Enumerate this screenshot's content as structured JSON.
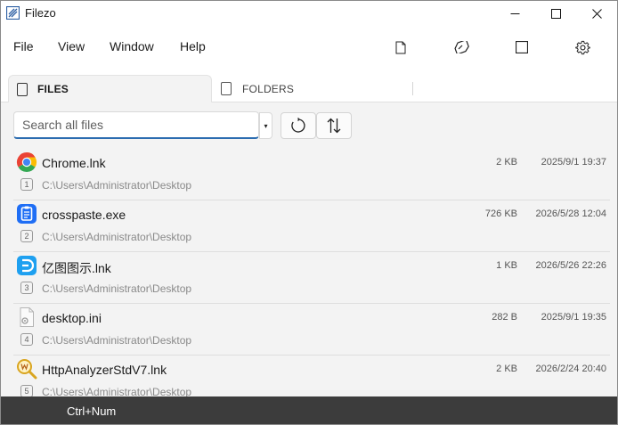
{
  "window": {
    "title": "Filezo",
    "controls": [
      "minimize-icon",
      "maximize-icon",
      "close-icon"
    ]
  },
  "menu": {
    "items": [
      "File",
      "View",
      "Window",
      "Help"
    ],
    "tools": [
      "new-file-icon",
      "eraser-icon",
      "square-icon",
      "gear-icon"
    ]
  },
  "tabs": {
    "files": "FILES",
    "folders": "FOLDERS",
    "active": "FILES"
  },
  "search": {
    "placeholder": "Search all files",
    "value": "",
    "dropdown_glyph": "▾"
  },
  "toolbar": {
    "refresh_icon": "refresh-icon",
    "sort_icon": "sort-icon"
  },
  "files": [
    {
      "name": "Chrome.lnk",
      "size": "2 KB",
      "date": "2025/9/1 19:37",
      "num": "1",
      "path": "C:\\Users\\Administrator\\Desktop",
      "icon": "chrome-icon"
    },
    {
      "name": "crosspaste.exe",
      "size": "726 KB",
      "date": "2026/5/28 12:04",
      "num": "2",
      "path": "C:\\Users\\Administrator\\Desktop",
      "icon": "crosspaste-icon"
    },
    {
      "name": "亿图图示.lnk",
      "size": "1 KB",
      "date": "2026/5/26 22:26",
      "num": "3",
      "path": "C:\\Users\\Administrator\\Desktop",
      "icon": "edraw-icon"
    },
    {
      "name": "desktop.ini",
      "size": "282 B",
      "date": "2025/9/1 19:35",
      "num": "4",
      "path": "C:\\Users\\Administrator\\Desktop",
      "icon": "settings-file-icon"
    },
    {
      "name": "HttpAnalyzerStdV7.lnk",
      "size": "2 KB",
      "date": "2026/2/24 20:40",
      "num": "5",
      "path": "C:\\Users\\Administrator\\Desktop",
      "icon": "magnifier-icon"
    }
  ],
  "status": {
    "text": "Ctrl+Num"
  },
  "colors": {
    "accent": "#2b6cb0",
    "statusbar": "#3c3c3c",
    "background": "#f3f3f3"
  }
}
